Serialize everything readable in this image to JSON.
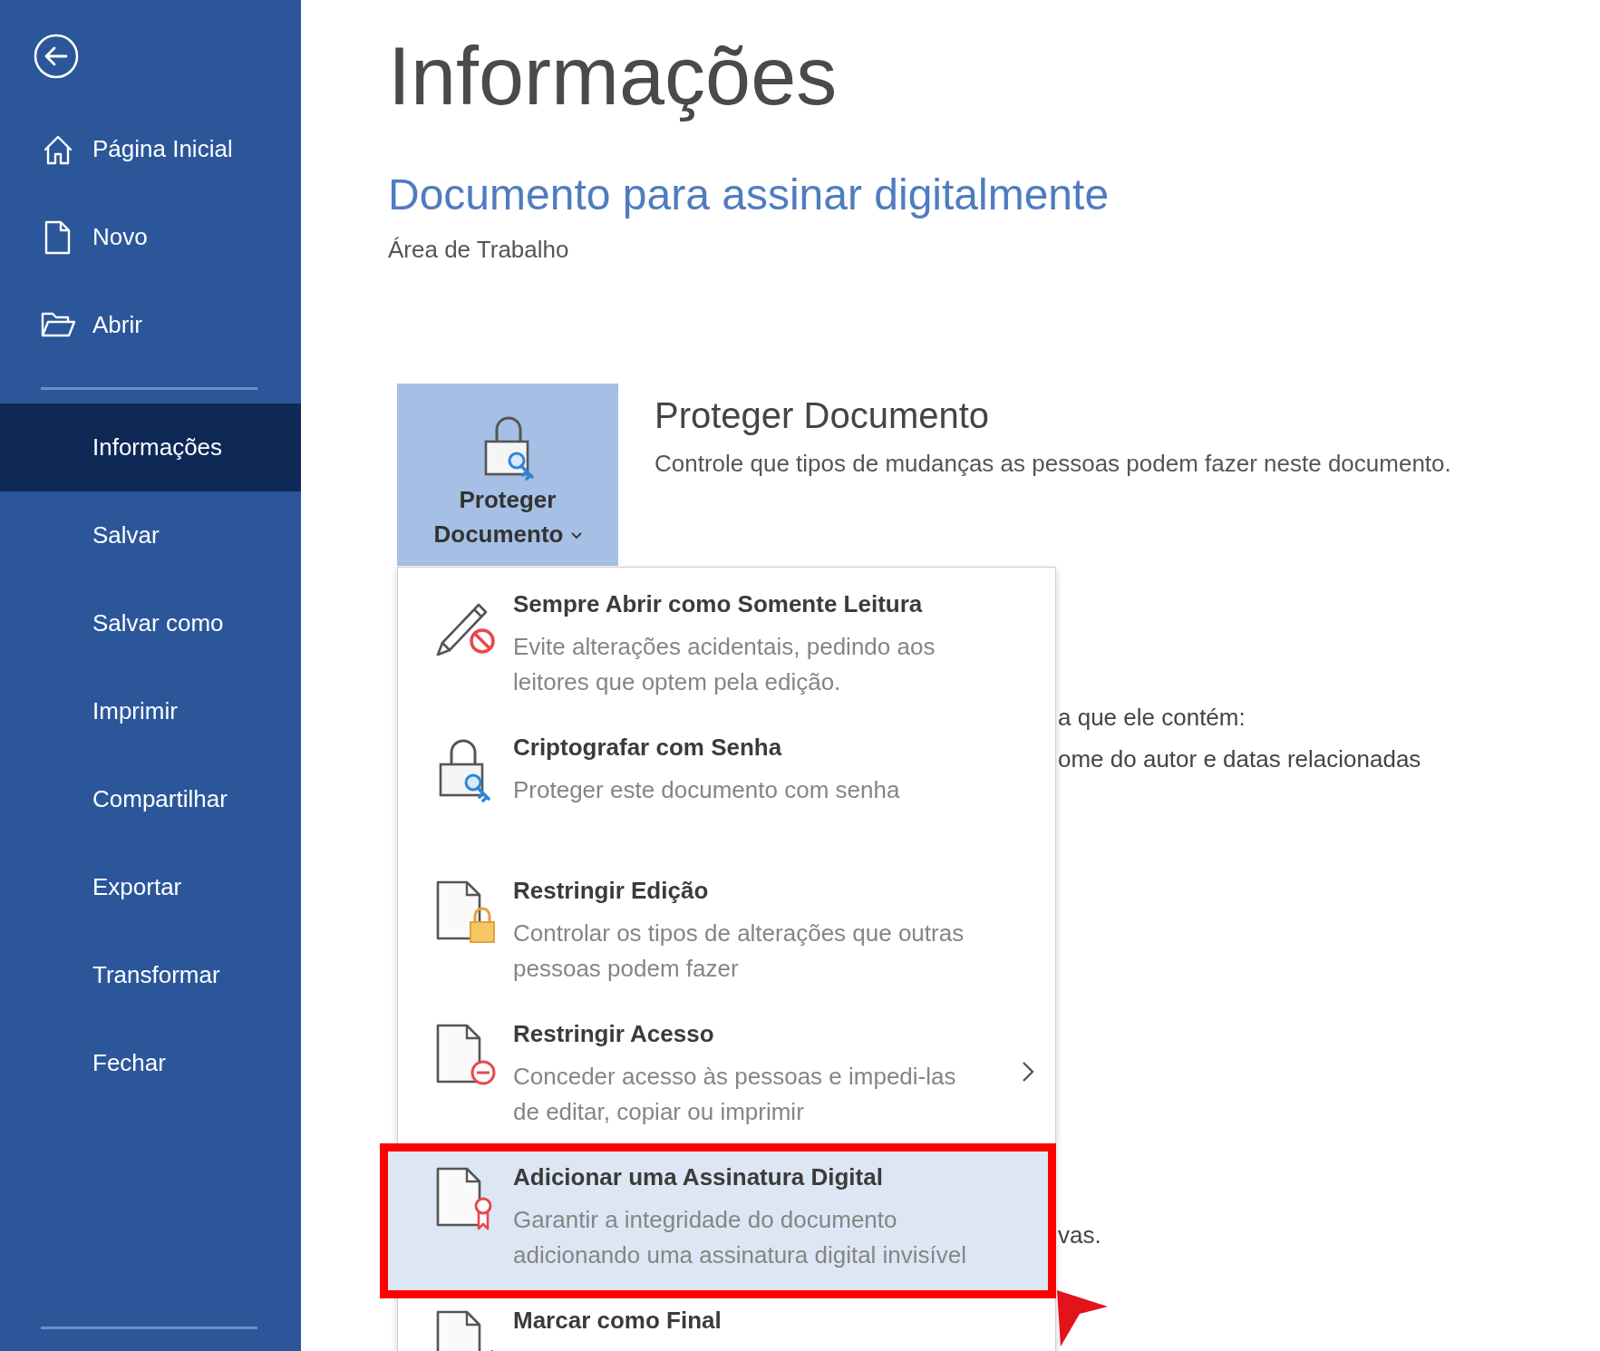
{
  "sidebar": {
    "top_items": [
      {
        "label": "Página Inicial",
        "selected": false
      },
      {
        "label": "Novo",
        "selected": false
      },
      {
        "label": "Abrir",
        "selected": false
      }
    ],
    "items": [
      {
        "label": "Informações",
        "selected": true
      },
      {
        "label": "Salvar",
        "selected": false
      },
      {
        "label": "Salvar como",
        "selected": false
      },
      {
        "label": "Imprimir",
        "selected": false
      },
      {
        "label": "Compartilhar",
        "selected": false
      },
      {
        "label": "Exportar",
        "selected": false
      },
      {
        "label": "Transformar",
        "selected": false
      },
      {
        "label": "Fechar",
        "selected": false
      }
    ]
  },
  "page": {
    "title": "Informações",
    "document_name": "Documento para assinar digitalmente",
    "location": "Área de Trabalho"
  },
  "protect_document": {
    "button_label": "Proteger Documento",
    "expanded": true,
    "heading": "Proteger Documento",
    "description": "Controle que tipos de mudanças as pessoas podem fazer neste documento."
  },
  "protect_menu": {
    "items": [
      {
        "title": "Sempre Abrir como Somente Leitura",
        "description": "Evite alterações acidentais, pedindo aos leitores que optem pela edição.",
        "selected": false,
        "has_submenu": false,
        "annotated": false
      },
      {
        "title": "Criptografar com Senha",
        "description": "Proteger este documento com senha",
        "selected": false,
        "has_submenu": false,
        "annotated": false
      },
      {
        "title": "Restringir Edição",
        "description": "Controlar os tipos de alterações que outras pessoas podem fazer",
        "selected": false,
        "has_submenu": false,
        "annotated": false
      },
      {
        "title": "Restringir Acesso",
        "description": "Conceder acesso às pessoas e impedi-las de editar, copiar ou imprimir",
        "selected": false,
        "has_submenu": true,
        "annotated": false
      },
      {
        "title": "Adicionar uma Assinatura Digital",
        "description": "Garantir a integridade do documento adicionando uma assinatura digital invisível",
        "selected": true,
        "has_submenu": false,
        "annotated": true
      },
      {
        "title": "Marcar como Final",
        "selected": false,
        "has_submenu": false,
        "annotated": false
      }
    ]
  },
  "covered_sections": [
    {
      "lines": [
        "a que ele contém:",
        "ome do autor e datas relacionadas"
      ]
    },
    {
      "lines": [
        "vas."
      ]
    }
  ]
}
